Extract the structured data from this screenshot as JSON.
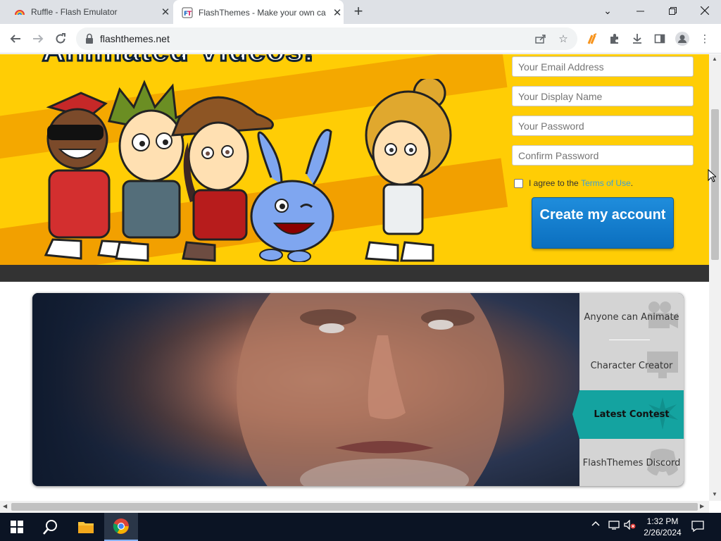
{
  "browser": {
    "tabs": [
      {
        "title": "Ruffle - Flash Emulator",
        "active": false
      },
      {
        "title": "FlashThemes - Make your own ca",
        "active": true
      }
    ],
    "url": "flashthemes.net"
  },
  "hero": {
    "title": "Animated Videos!",
    "signup": {
      "email_placeholder": "Your Email Address",
      "display_name_placeholder": "Your Display Name",
      "password_placeholder": "Your Password",
      "confirm_placeholder": "Confirm Password",
      "agree_prefix": "I agree to the ",
      "terms_link": "Terms of Use",
      "agree_suffix": ".",
      "create_button": "Create my account"
    }
  },
  "slider": {
    "menu": [
      {
        "label": "Anyone can Animate",
        "active": false
      },
      {
        "label": "Character Creator",
        "active": false
      },
      {
        "label": "Latest Contest",
        "active": true
      },
      {
        "label": "FlashThemes Discord",
        "active": false
      }
    ]
  },
  "taskbar": {
    "time": "1:32 PM",
    "date": "2/26/2024"
  },
  "colors": {
    "hero_bg": "#ffcd05",
    "button_blue": "#1f8ddc",
    "active_tab_teal": "#14a3a0",
    "terms_link": "#3aa0d8"
  }
}
